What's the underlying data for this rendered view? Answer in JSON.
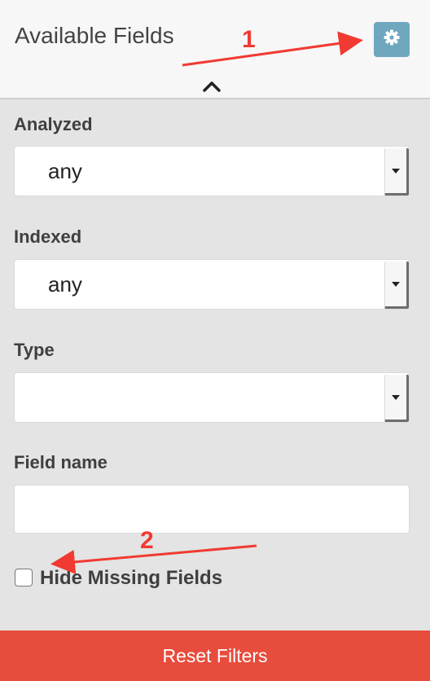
{
  "header": {
    "title": "Available Fields",
    "settings_icon": "gear-icon",
    "collapse_icon": "chevron-up-icon"
  },
  "filters": {
    "analyzed": {
      "label": "Analyzed",
      "value": "any"
    },
    "indexed": {
      "label": "Indexed",
      "value": "any"
    },
    "type": {
      "label": "Type",
      "value": ""
    },
    "field_name": {
      "label": "Field name",
      "value": "",
      "placeholder": ""
    }
  },
  "hide_missing": {
    "label": "Hide Missing Fields",
    "checked": false
  },
  "reset_button": {
    "label": "Reset Filters"
  },
  "annotations": {
    "one": "1",
    "two": "2",
    "color": "#f03a32"
  },
  "colors": {
    "header_bg": "#f7f7f7",
    "panel_bg": "#e4e4e4",
    "gear_button": "#6fa7bf",
    "reset_button": "#e74c3c"
  }
}
